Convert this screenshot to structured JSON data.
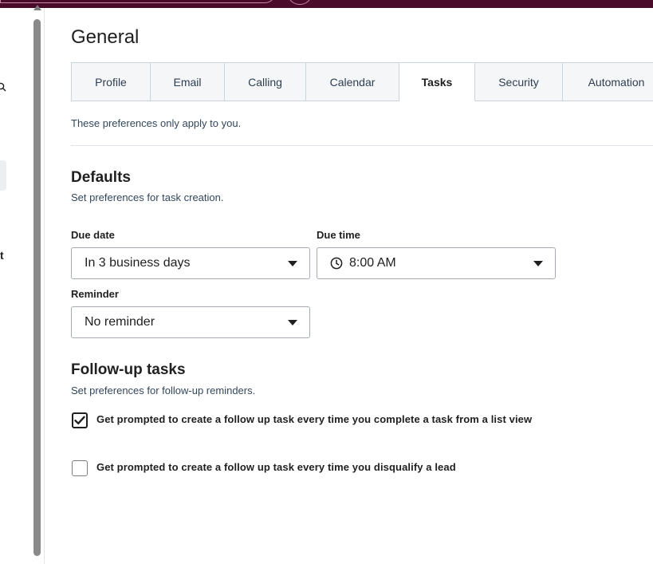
{
  "page": {
    "title": "General"
  },
  "tabs": [
    {
      "label": "Profile"
    },
    {
      "label": "Email"
    },
    {
      "label": "Calling"
    },
    {
      "label": "Calendar"
    },
    {
      "label": "Tasks",
      "active": true
    },
    {
      "label": "Security"
    },
    {
      "label": "Automation"
    }
  ],
  "intro": "These preferences only apply to you.",
  "sidebar": {
    "fragment_text": "t"
  },
  "defaults": {
    "title": "Defaults",
    "subtitle": "Set preferences for task creation.",
    "due_date": {
      "label": "Due date",
      "value": "In 3 business days"
    },
    "due_time": {
      "label": "Due time",
      "value": "8:00 AM"
    },
    "reminder": {
      "label": "Reminder",
      "value": "No reminder"
    }
  },
  "followup": {
    "title": "Follow-up tasks",
    "subtitle": "Set preferences for follow-up reminders.",
    "options": [
      {
        "label": "Get prompted to create a follow up task every time you complete a task from a list view",
        "checked": true
      },
      {
        "label": "Get prompted to create a follow up task every time you disqualify a lead",
        "checked": false
      }
    ]
  },
  "colors": {
    "topbar": "#4a0a2a",
    "text": "#1f1f1f",
    "border": "#a6abb3"
  }
}
